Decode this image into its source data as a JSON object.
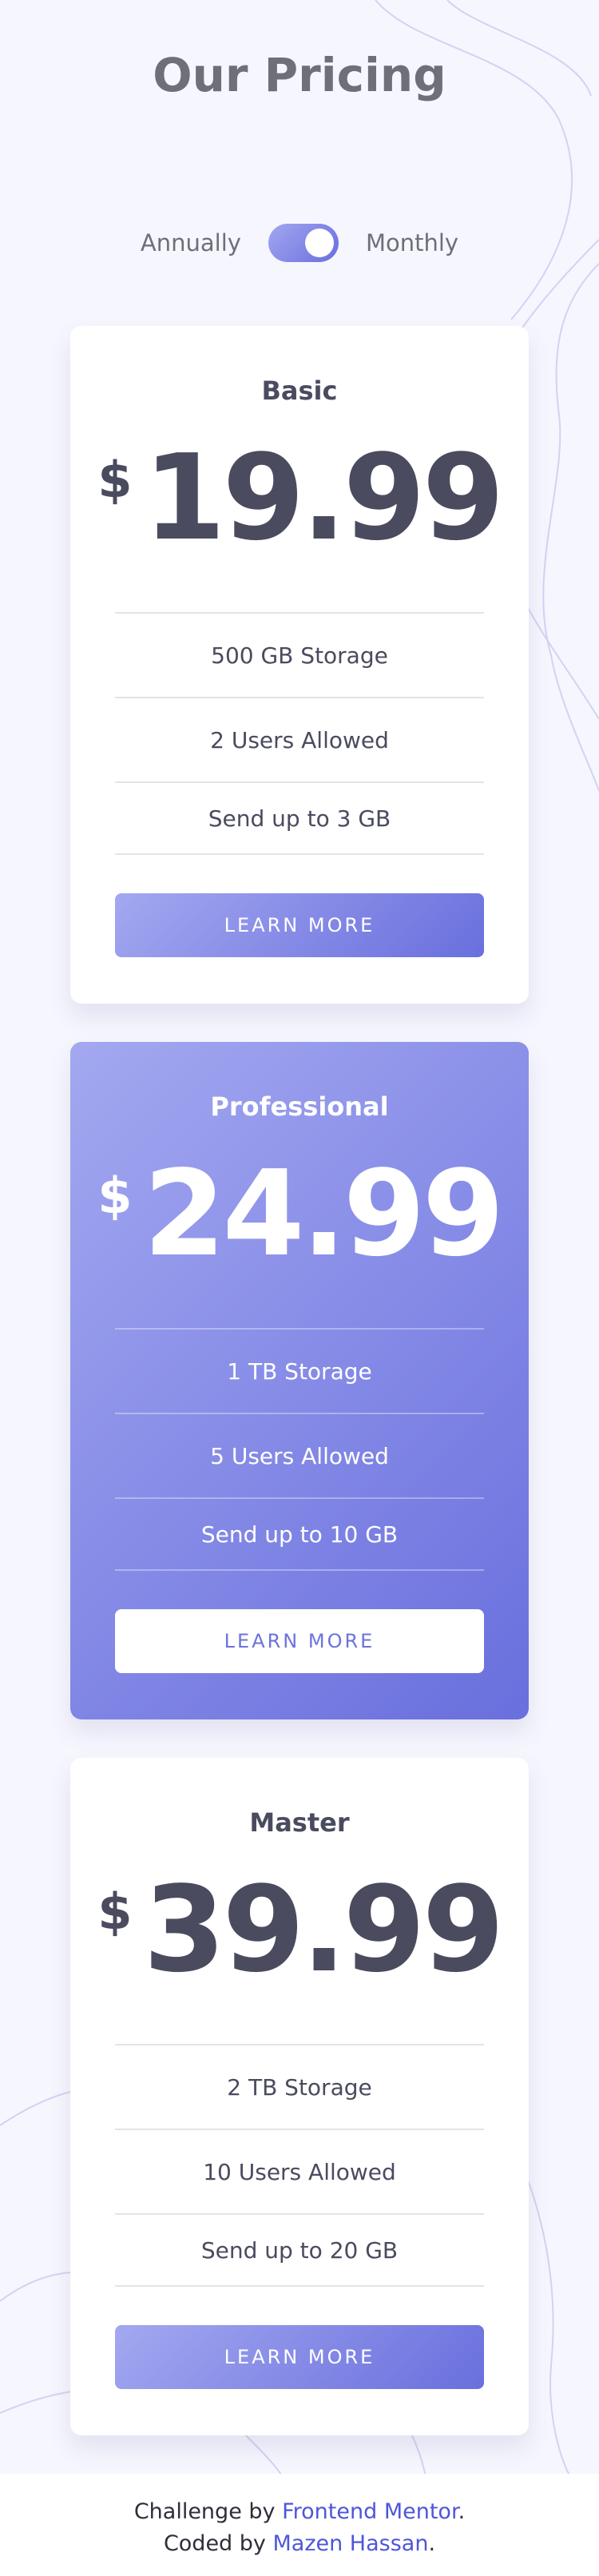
{
  "header": {
    "title": "Our Pricing"
  },
  "billing_toggle": {
    "left_label": "Annually",
    "right_label": "Monthly",
    "selected": "Monthly"
  },
  "plans": [
    {
      "name": "Basic",
      "currency": "$",
      "price": "19.99",
      "features": [
        "500 GB Storage",
        "2 Users Allowed",
        "Send up to 3 GB"
      ],
      "cta": "LEARN MORE"
    },
    {
      "name": "Professional",
      "currency": "$",
      "price": "24.99",
      "features": [
        "1 TB Storage",
        "5 Users Allowed",
        "Send up to 10 GB"
      ],
      "cta": "LEARN MORE"
    },
    {
      "name": "Master",
      "currency": "$",
      "price": "39.99",
      "features": [
        "2 TB Storage",
        "10 Users Allowed",
        "Send up to 20 GB"
      ],
      "cta": "LEARN MORE"
    }
  ],
  "footer": {
    "line1_prefix": "Challenge by ",
    "line1_link": "Frontend Mentor",
    "line1_suffix": ".",
    "line2_prefix": "Coded by ",
    "line2_link": "Mazen Hassan",
    "line2_suffix": "."
  },
  "colors": {
    "background": "#f6f6fe",
    "accent_gradient_start": "#a3a8f0",
    "accent_gradient_end": "#696fdd",
    "text_dark": "#4a4b5e",
    "link": "#4e56d9"
  }
}
